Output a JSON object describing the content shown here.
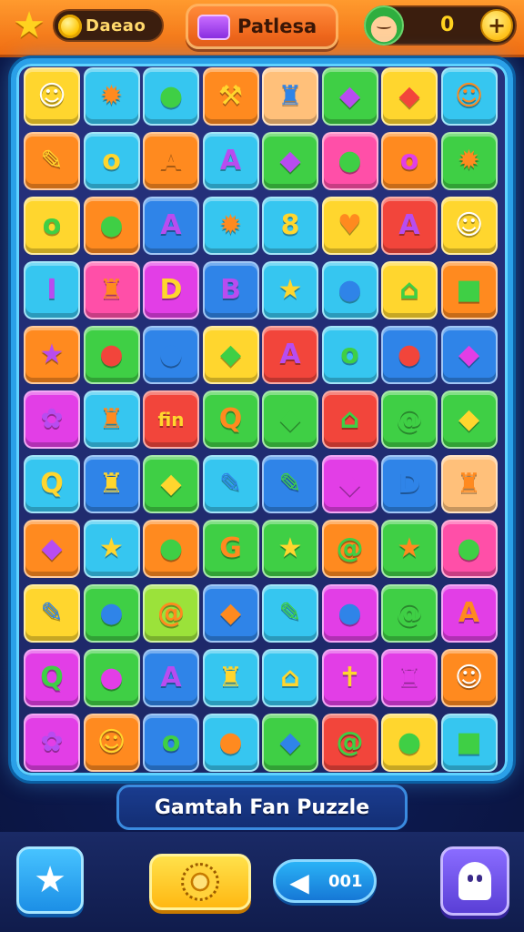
{
  "header": {
    "currency_label": "Daeao",
    "title": "Patlesa",
    "score": "0",
    "plus_symbol": "+"
  },
  "banner": {
    "title": "Gamtah Fan Puzzle"
  },
  "bottom_bar": {
    "sound_label": "001"
  },
  "colors": {
    "yellow": "#ffd62e",
    "cyan": "#36c6f0",
    "blue": "#2f84e8",
    "green": "#3fcf45",
    "orange": "#ff8a1f",
    "red": "#f2453b",
    "pink": "#ff4fa8",
    "purple": "#b84cf0",
    "magenta": "#e23ee6",
    "peach": "#ffc07a",
    "lime": "#9be23a"
  },
  "board": {
    "rows": [
      [
        {
          "c": "yellow",
          "g": "☺",
          "gc": "#ffffff"
        },
        {
          "c": "cyan",
          "g": "✹",
          "gc": "#ff8a1f"
        },
        {
          "c": "cyan",
          "g": "●",
          "gc": "#3fcf45"
        },
        {
          "c": "orange",
          "g": "⚒",
          "gc": "#ffd62e"
        },
        {
          "c": "peach",
          "g": "♜",
          "gc": "#2f84e8"
        },
        {
          "c": "green",
          "g": "◆",
          "gc": "#b84cf0"
        },
        {
          "c": "yellow",
          "g": "◆",
          "gc": "#f2453b"
        },
        {
          "c": "cyan",
          "g": "☺",
          "gc": "#ff8a1f"
        }
      ],
      [
        {
          "c": "orange",
          "g": "✎",
          "gc": "#ffd62e"
        },
        {
          "c": "cyan",
          "g": "o",
          "gc": "#ffd62e"
        },
        {
          "c": "orange",
          "g": "A",
          "gc": "#ff8a1f"
        },
        {
          "c": "cyan",
          "g": "A",
          "gc": "#b84cf0"
        },
        {
          "c": "green",
          "g": "◆",
          "gc": "#b84cf0"
        },
        {
          "c": "pink",
          "g": "●",
          "gc": "#3fcf45"
        },
        {
          "c": "orange",
          "g": "o",
          "gc": "#e23ee6"
        },
        {
          "c": "green",
          "g": "✹",
          "gc": "#ff8a1f"
        }
      ],
      [
        {
          "c": "yellow",
          "g": "o",
          "gc": "#3fcf45"
        },
        {
          "c": "orange",
          "g": "●",
          "gc": "#3fcf45"
        },
        {
          "c": "blue",
          "g": "A",
          "gc": "#b84cf0"
        },
        {
          "c": "cyan",
          "g": "✹",
          "gc": "#ff8a1f"
        },
        {
          "c": "cyan",
          "g": "8",
          "gc": "#ffd62e"
        },
        {
          "c": "yellow",
          "g": "♥",
          "gc": "#ff8a1f"
        },
        {
          "c": "red",
          "g": "A",
          "gc": "#b84cf0"
        },
        {
          "c": "yellow",
          "g": "☺",
          "gc": "#ffffff"
        }
      ],
      [
        {
          "c": "cyan",
          "g": "I",
          "gc": "#b84cf0"
        },
        {
          "c": "pink",
          "g": "♜",
          "gc": "#ff8a1f"
        },
        {
          "c": "magenta",
          "g": "D",
          "gc": "#ffd62e"
        },
        {
          "c": "blue",
          "g": "B",
          "gc": "#b84cf0"
        },
        {
          "c": "cyan",
          "g": "★",
          "gc": "#ffd62e"
        },
        {
          "c": "cyan",
          "g": "●",
          "gc": "#2f84e8"
        },
        {
          "c": "yellow",
          "g": "⌂",
          "gc": "#3fcf45"
        },
        {
          "c": "orange",
          "g": "■",
          "gc": "#3fcf45"
        }
      ],
      [
        {
          "c": "orange",
          "g": "★",
          "gc": "#b84cf0"
        },
        {
          "c": "green",
          "g": "●",
          "gc": "#f2453b"
        },
        {
          "c": "blue",
          "g": "●",
          "gc": "#2f84e8"
        },
        {
          "c": "yellow",
          "g": "◆",
          "gc": "#3fcf45"
        },
        {
          "c": "red",
          "g": "A",
          "gc": "#b84cf0"
        },
        {
          "c": "cyan",
          "g": "o",
          "gc": "#3fcf45"
        },
        {
          "c": "blue",
          "g": "●",
          "gc": "#f2453b"
        },
        {
          "c": "blue",
          "g": "◆",
          "gc": "#e23ee6"
        }
      ],
      [
        {
          "c": "magenta",
          "g": "✿",
          "gc": "#b84cf0"
        },
        {
          "c": "cyan",
          "g": "♜",
          "gc": "#ff8a1f"
        },
        {
          "c": "red",
          "g": "fin",
          "gc": "#ffd62e"
        },
        {
          "c": "green",
          "g": "Q",
          "gc": "#ff8a1f"
        },
        {
          "c": "green",
          "g": "◆",
          "gc": "#3fcf45"
        },
        {
          "c": "red",
          "g": "⌂",
          "gc": "#3fcf45"
        },
        {
          "c": "green",
          "g": "@",
          "gc": "#3fcf45"
        },
        {
          "c": "green",
          "g": "◆",
          "gc": "#ffd62e"
        }
      ],
      [
        {
          "c": "cyan",
          "g": "Q",
          "gc": "#ffd62e"
        },
        {
          "c": "blue",
          "g": "♜",
          "gc": "#ffd62e"
        },
        {
          "c": "green",
          "g": "◆",
          "gc": "#ffd62e"
        },
        {
          "c": "cyan",
          "g": "✎",
          "gc": "#2f84e8"
        },
        {
          "c": "blue",
          "g": "✎",
          "gc": "#3fcf45"
        },
        {
          "c": "magenta",
          "g": "◆",
          "gc": "#e23ee6"
        },
        {
          "c": "blue",
          "g": "D",
          "gc": "#2f84e8"
        },
        {
          "c": "peach",
          "g": "♜",
          "gc": "#ff8a1f"
        }
      ],
      [
        {
          "c": "orange",
          "g": "◆",
          "gc": "#b84cf0"
        },
        {
          "c": "cyan",
          "g": "★",
          "gc": "#ffd62e"
        },
        {
          "c": "orange",
          "g": "●",
          "gc": "#3fcf45"
        },
        {
          "c": "green",
          "g": "G",
          "gc": "#ff8a1f"
        },
        {
          "c": "green",
          "g": "★",
          "gc": "#ffd62e"
        },
        {
          "c": "orange",
          "g": "@",
          "gc": "#3fcf45"
        },
        {
          "c": "green",
          "g": "★",
          "gc": "#ff8a1f"
        },
        {
          "c": "pink",
          "g": "●",
          "gc": "#3fcf45"
        }
      ],
      [
        {
          "c": "yellow",
          "g": "✎",
          "gc": "#2f84e8"
        },
        {
          "c": "green",
          "g": "●",
          "gc": "#2f84e8"
        },
        {
          "c": "lime",
          "g": "@",
          "gc": "#ff8a1f"
        },
        {
          "c": "blue",
          "g": "◆",
          "gc": "#ff8a1f"
        },
        {
          "c": "cyan",
          "g": "✎",
          "gc": "#3fcf45"
        },
        {
          "c": "magenta",
          "g": "●",
          "gc": "#2f84e8"
        },
        {
          "c": "green",
          "g": "@",
          "gc": "#3fcf45"
        },
        {
          "c": "magenta",
          "g": "A",
          "gc": "#ff8a1f"
        }
      ],
      [
        {
          "c": "magenta",
          "g": "Q",
          "gc": "#3fcf45"
        },
        {
          "c": "green",
          "g": "●",
          "gc": "#e23ee6"
        },
        {
          "c": "blue",
          "g": "A",
          "gc": "#b84cf0"
        },
        {
          "c": "cyan",
          "g": "♜",
          "gc": "#ffd62e"
        },
        {
          "c": "cyan",
          "g": "⌂",
          "gc": "#ffd62e"
        },
        {
          "c": "magenta",
          "g": "✝",
          "gc": "#ffd62e"
        },
        {
          "c": "magenta",
          "g": "♜",
          "gc": "#e23ee6"
        },
        {
          "c": "orange",
          "g": "☺",
          "gc": "#ffffff"
        }
      ],
      [
        {
          "c": "magenta",
          "g": "✿",
          "gc": "#b84cf0"
        },
        {
          "c": "orange",
          "g": "☺",
          "gc": "#ffd62e"
        },
        {
          "c": "blue",
          "g": "o",
          "gc": "#3fcf45"
        },
        {
          "c": "cyan",
          "g": "●",
          "gc": "#ff8a1f"
        },
        {
          "c": "green",
          "g": "◆",
          "gc": "#2f84e8"
        },
        {
          "c": "red",
          "g": "@",
          "gc": "#3fcf45"
        },
        {
          "c": "yellow",
          "g": "●",
          "gc": "#3fcf45"
        },
        {
          "c": "cyan",
          "g": "■",
          "gc": "#3fcf45"
        }
      ]
    ]
  }
}
